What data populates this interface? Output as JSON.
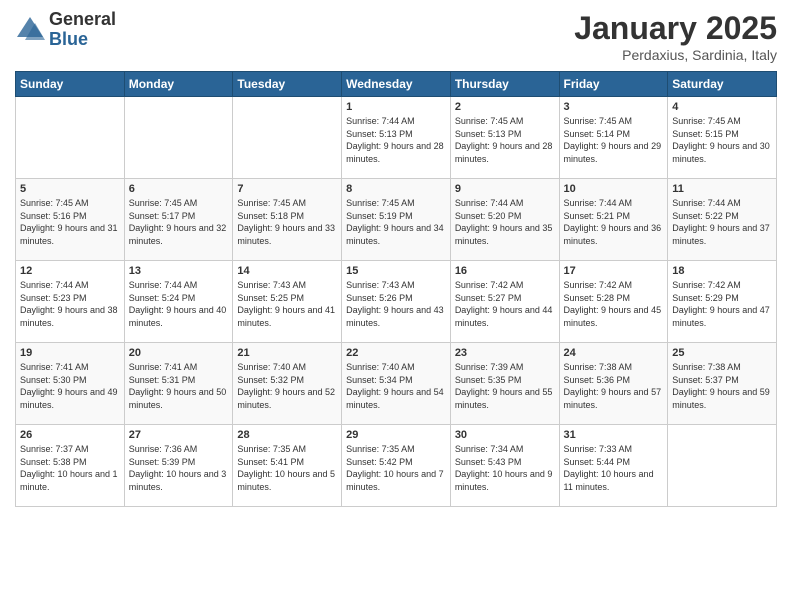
{
  "logo": {
    "general": "General",
    "blue": "Blue"
  },
  "title": "January 2025",
  "subtitle": "Perdaxius, Sardinia, Italy",
  "days_of_week": [
    "Sunday",
    "Monday",
    "Tuesday",
    "Wednesday",
    "Thursday",
    "Friday",
    "Saturday"
  ],
  "weeks": [
    [
      {
        "day": "",
        "info": ""
      },
      {
        "day": "",
        "info": ""
      },
      {
        "day": "",
        "info": ""
      },
      {
        "day": "1",
        "info": "Sunrise: 7:44 AM\nSunset: 5:13 PM\nDaylight: 9 hours and 28 minutes."
      },
      {
        "day": "2",
        "info": "Sunrise: 7:45 AM\nSunset: 5:13 PM\nDaylight: 9 hours and 28 minutes."
      },
      {
        "day": "3",
        "info": "Sunrise: 7:45 AM\nSunset: 5:14 PM\nDaylight: 9 hours and 29 minutes."
      },
      {
        "day": "4",
        "info": "Sunrise: 7:45 AM\nSunset: 5:15 PM\nDaylight: 9 hours and 30 minutes."
      }
    ],
    [
      {
        "day": "5",
        "info": "Sunrise: 7:45 AM\nSunset: 5:16 PM\nDaylight: 9 hours and 31 minutes."
      },
      {
        "day": "6",
        "info": "Sunrise: 7:45 AM\nSunset: 5:17 PM\nDaylight: 9 hours and 32 minutes."
      },
      {
        "day": "7",
        "info": "Sunrise: 7:45 AM\nSunset: 5:18 PM\nDaylight: 9 hours and 33 minutes."
      },
      {
        "day": "8",
        "info": "Sunrise: 7:45 AM\nSunset: 5:19 PM\nDaylight: 9 hours and 34 minutes."
      },
      {
        "day": "9",
        "info": "Sunrise: 7:44 AM\nSunset: 5:20 PM\nDaylight: 9 hours and 35 minutes."
      },
      {
        "day": "10",
        "info": "Sunrise: 7:44 AM\nSunset: 5:21 PM\nDaylight: 9 hours and 36 minutes."
      },
      {
        "day": "11",
        "info": "Sunrise: 7:44 AM\nSunset: 5:22 PM\nDaylight: 9 hours and 37 minutes."
      }
    ],
    [
      {
        "day": "12",
        "info": "Sunrise: 7:44 AM\nSunset: 5:23 PM\nDaylight: 9 hours and 38 minutes."
      },
      {
        "day": "13",
        "info": "Sunrise: 7:44 AM\nSunset: 5:24 PM\nDaylight: 9 hours and 40 minutes."
      },
      {
        "day": "14",
        "info": "Sunrise: 7:43 AM\nSunset: 5:25 PM\nDaylight: 9 hours and 41 minutes."
      },
      {
        "day": "15",
        "info": "Sunrise: 7:43 AM\nSunset: 5:26 PM\nDaylight: 9 hours and 43 minutes."
      },
      {
        "day": "16",
        "info": "Sunrise: 7:42 AM\nSunset: 5:27 PM\nDaylight: 9 hours and 44 minutes."
      },
      {
        "day": "17",
        "info": "Sunrise: 7:42 AM\nSunset: 5:28 PM\nDaylight: 9 hours and 45 minutes."
      },
      {
        "day": "18",
        "info": "Sunrise: 7:42 AM\nSunset: 5:29 PM\nDaylight: 9 hours and 47 minutes."
      }
    ],
    [
      {
        "day": "19",
        "info": "Sunrise: 7:41 AM\nSunset: 5:30 PM\nDaylight: 9 hours and 49 minutes."
      },
      {
        "day": "20",
        "info": "Sunrise: 7:41 AM\nSunset: 5:31 PM\nDaylight: 9 hours and 50 minutes."
      },
      {
        "day": "21",
        "info": "Sunrise: 7:40 AM\nSunset: 5:32 PM\nDaylight: 9 hours and 52 minutes."
      },
      {
        "day": "22",
        "info": "Sunrise: 7:40 AM\nSunset: 5:34 PM\nDaylight: 9 hours and 54 minutes."
      },
      {
        "day": "23",
        "info": "Sunrise: 7:39 AM\nSunset: 5:35 PM\nDaylight: 9 hours and 55 minutes."
      },
      {
        "day": "24",
        "info": "Sunrise: 7:38 AM\nSunset: 5:36 PM\nDaylight: 9 hours and 57 minutes."
      },
      {
        "day": "25",
        "info": "Sunrise: 7:38 AM\nSunset: 5:37 PM\nDaylight: 9 hours and 59 minutes."
      }
    ],
    [
      {
        "day": "26",
        "info": "Sunrise: 7:37 AM\nSunset: 5:38 PM\nDaylight: 10 hours and 1 minute."
      },
      {
        "day": "27",
        "info": "Sunrise: 7:36 AM\nSunset: 5:39 PM\nDaylight: 10 hours and 3 minutes."
      },
      {
        "day": "28",
        "info": "Sunrise: 7:35 AM\nSunset: 5:41 PM\nDaylight: 10 hours and 5 minutes."
      },
      {
        "day": "29",
        "info": "Sunrise: 7:35 AM\nSunset: 5:42 PM\nDaylight: 10 hours and 7 minutes."
      },
      {
        "day": "30",
        "info": "Sunrise: 7:34 AM\nSunset: 5:43 PM\nDaylight: 10 hours and 9 minutes."
      },
      {
        "day": "31",
        "info": "Sunrise: 7:33 AM\nSunset: 5:44 PM\nDaylight: 10 hours and 11 minutes."
      },
      {
        "day": "",
        "info": ""
      }
    ]
  ]
}
